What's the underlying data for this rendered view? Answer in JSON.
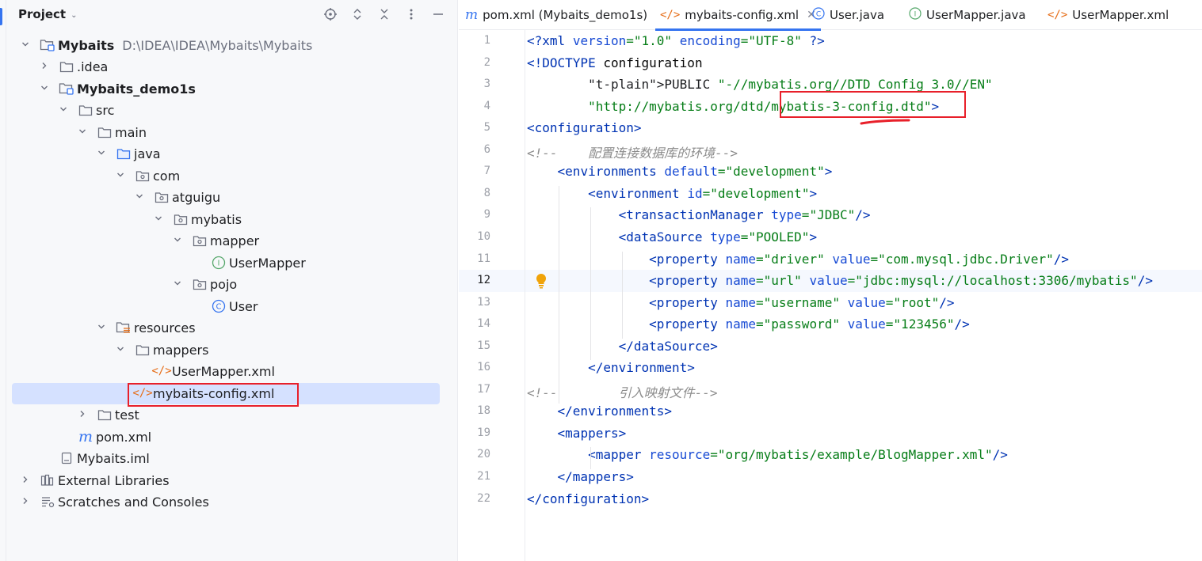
{
  "project_panel": {
    "title": "Project",
    "tree": [
      {
        "label": "Mybaits",
        "path": "D:\\IDEA\\IDEA\\Mybaits\\Mybaits",
        "icon": "module-folder-icon",
        "bold": true
      },
      {
        "label": ".idea",
        "icon": "folder-icon"
      },
      {
        "label": "Mybaits_demo1s",
        "icon": "module-folder-icon",
        "bold": true
      },
      {
        "label": "src",
        "icon": "folder-icon"
      },
      {
        "label": "main",
        "icon": "folder-icon"
      },
      {
        "label": "java",
        "icon": "source-folder-icon"
      },
      {
        "label": "com",
        "icon": "package-icon"
      },
      {
        "label": "atguigu",
        "icon": "package-icon"
      },
      {
        "label": "mybatis",
        "icon": "package-icon"
      },
      {
        "label": "mapper",
        "icon": "package-icon"
      },
      {
        "label": "UserMapper",
        "icon": "interface-icon"
      },
      {
        "label": "pojo",
        "icon": "package-icon"
      },
      {
        "label": "User",
        "icon": "class-icon"
      },
      {
        "label": "resources",
        "icon": "resources-folder-icon"
      },
      {
        "label": "mappers",
        "icon": "folder-icon"
      },
      {
        "label": "UserMapper.xml",
        "icon": "xml-file-icon"
      },
      {
        "label": "mybaits-config.xml",
        "icon": "xml-file-icon",
        "selected": true
      },
      {
        "label": "test",
        "icon": "folder-icon"
      },
      {
        "label": "pom.xml",
        "icon": "maven-icon"
      },
      {
        "label": "Mybaits.iml",
        "icon": "iml-file-icon"
      },
      {
        "label": "External Libraries",
        "icon": "library-icon"
      },
      {
        "label": "Scratches and Consoles",
        "icon": "scratches-icon"
      }
    ]
  },
  "tabs": [
    {
      "label": "pom.xml (Mybaits_demo1s)",
      "icon": "maven-icon"
    },
    {
      "label": "mybaits-config.xml",
      "icon": "xml-file-icon",
      "active": true
    },
    {
      "label": "User.java",
      "icon": "class-icon"
    },
    {
      "label": "UserMapper.java",
      "icon": "interface-icon"
    },
    {
      "label": "UserMapper.xml",
      "icon": "xml-file-icon"
    }
  ],
  "editor": {
    "current_line": 12,
    "line_numbers": [
      "1",
      "2",
      "3",
      "4",
      "5",
      "6",
      "7",
      "8",
      "9",
      "10",
      "11",
      "12",
      "13",
      "14",
      "15",
      "16",
      "17",
      "18",
      "19",
      "20",
      "21",
      "22"
    ],
    "lines": [
      "<?xml version=\"1.0\" encoding=\"UTF-8\" ?>",
      "<!DOCTYPE configuration",
      "        PUBLIC \"-//mybatis.org//DTD Config 3.0//EN\"",
      "        \"http://mybatis.org/dtd/mybatis-3-config.dtd\">",
      "<configuration>",
      "<!--    配置连接数据库的环境-->",
      "    <environments default=\"development\">",
      "        <environment id=\"development\">",
      "            <transactionManager type=\"JDBC\"/>",
      "            <dataSource type=\"POOLED\">",
      "                <property name=\"driver\" value=\"com.mysql.jdbc.Driver\"/>",
      "                <property name=\"url\" value=\"jdbc:mysql://localhost:3306/mybatis\"/>",
      "                <property name=\"username\" value=\"root\"/>",
      "                <property name=\"password\" value=\"123456\"/>",
      "            </dataSource>",
      "        </environment>",
      "<!--        引入映射文件-->",
      "    </environments>",
      "    <mappers>",
      "        <mapper resource=\"org/mybatis/example/BlogMapper.xml\"/>",
      "    </mappers>",
      "</configuration>"
    ]
  },
  "colors": {
    "accent": "#3574f0",
    "selection": "#d5e1ff",
    "highlight_box": "#e8202a",
    "tag": "#0033b3",
    "string": "#067d17",
    "comment": "#8c8c8c"
  }
}
